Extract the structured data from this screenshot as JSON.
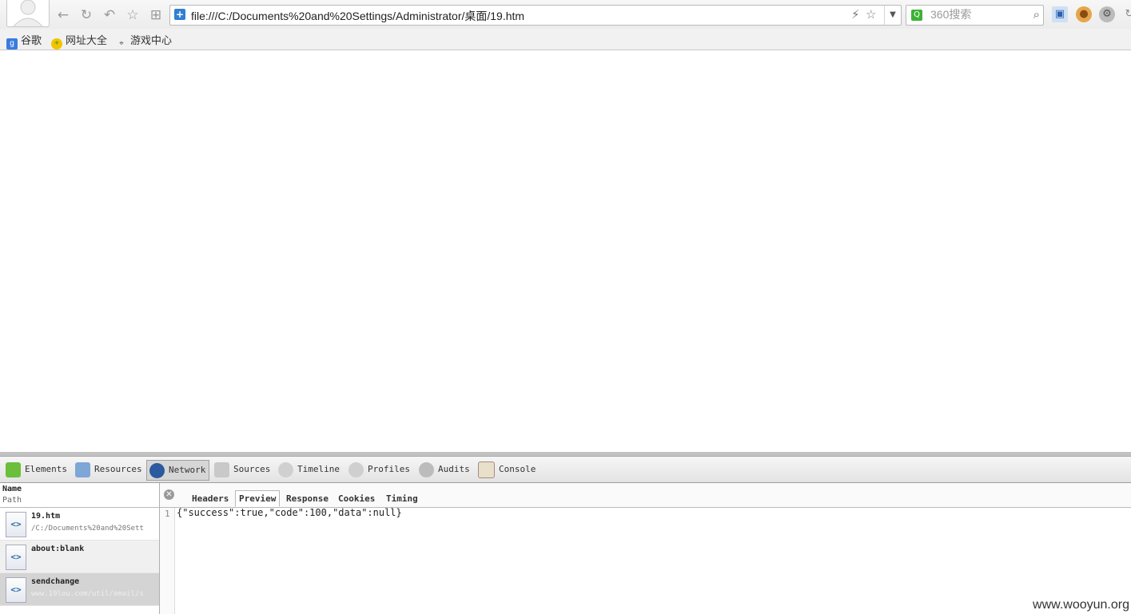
{
  "browser": {
    "url": "file:///C:/Documents%20and%20Settings/Administrator/桌面/19.htm",
    "search_placeholder": "360搜索",
    "bookmarks": [
      {
        "label": "谷歌"
      },
      {
        "label": "网址大全"
      },
      {
        "label": "游戏中心"
      }
    ]
  },
  "devtools": {
    "tabs": [
      {
        "label": "Elements"
      },
      {
        "label": "Resources"
      },
      {
        "label": "Network"
      },
      {
        "label": "Sources"
      },
      {
        "label": "Timeline"
      },
      {
        "label": "Profiles"
      },
      {
        "label": "Audits"
      },
      {
        "label": "Console"
      }
    ],
    "active_tab": "Network",
    "list_header": {
      "name": "Name",
      "path": "Path"
    },
    "requests": [
      {
        "name": "19.htm",
        "path": "/C:/Documents%20and%20Sett"
      },
      {
        "name": "about:blank",
        "path": ""
      },
      {
        "name": "sendchange",
        "path": "www.19lou.com/util/email/s"
      }
    ],
    "selected_request": "sendchange",
    "detail_tabs": [
      {
        "label": "Headers"
      },
      {
        "label": "Preview"
      },
      {
        "label": "Response"
      },
      {
        "label": "Cookies"
      },
      {
        "label": "Timing"
      }
    ],
    "active_detail_tab": "Preview",
    "preview": {
      "line_number": "1",
      "content": "{\"success\":true,\"code\":100,\"data\":null}"
    }
  },
  "watermark": "www.wooyun.org"
}
